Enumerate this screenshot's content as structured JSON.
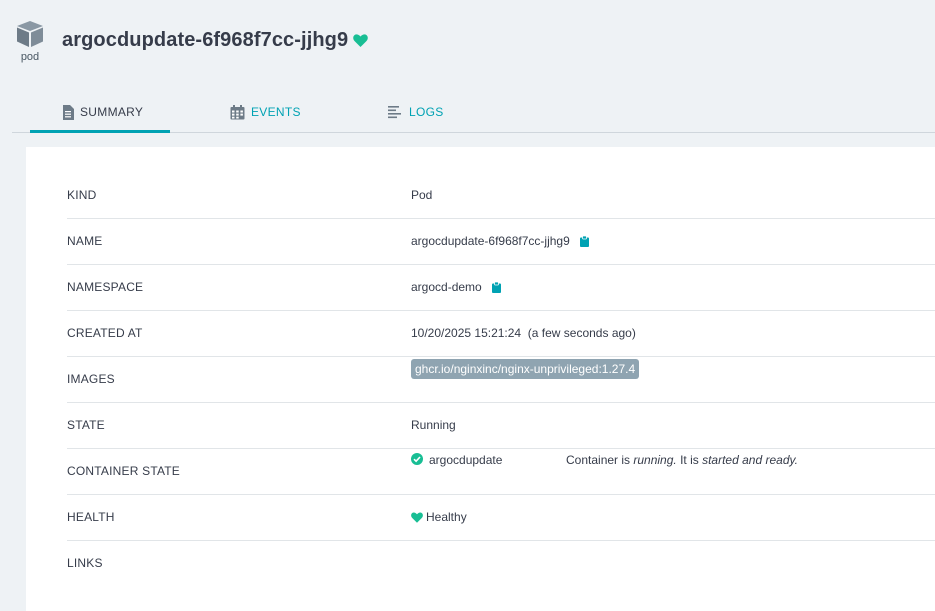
{
  "header": {
    "kind_label": "pod",
    "title": "argocdupdate-6f968f7cc-jjhg9",
    "kind_icon": "cube-icon",
    "health_icon": "heart-icon"
  },
  "tabs": [
    {
      "label": "SUMMARY",
      "icon": "document-icon",
      "active": true
    },
    {
      "label": "EVENTS",
      "icon": "calendar-icon",
      "active": false
    },
    {
      "label": "LOGS",
      "icon": "lines-icon",
      "active": false
    }
  ],
  "summary": {
    "kind": {
      "key": "KIND",
      "value": "Pod"
    },
    "name": {
      "key": "NAME",
      "value": "argocdupdate-6f968f7cc-jjhg9"
    },
    "namespace": {
      "key": "NAMESPACE",
      "value": "argocd-demo"
    },
    "created": {
      "key": "CREATED AT",
      "value": "10/20/2025 15:21:24  (a few seconds ago)"
    },
    "images": {
      "key": "IMAGES",
      "value": "ghcr.io/nginxinc/nginx-unprivileged:1.27.4"
    },
    "state": {
      "key": "STATE",
      "value": "Running"
    },
    "container_state": {
      "key": "CONTAINER STATE",
      "container": "argocdupdate",
      "msg_prefix": "Container is ",
      "msg_state": "running.",
      "msg_mid": " It is ",
      "msg_detail": "started and ready."
    },
    "health": {
      "key": "HEALTH",
      "value": "Healthy"
    },
    "links": {
      "key": "LINKS",
      "value": ""
    }
  },
  "colors": {
    "accent": "#00a2b3",
    "healthy": "#18be94",
    "image_tag_bg": "#8fa4b1",
    "page_bg": "#eef2f5"
  }
}
